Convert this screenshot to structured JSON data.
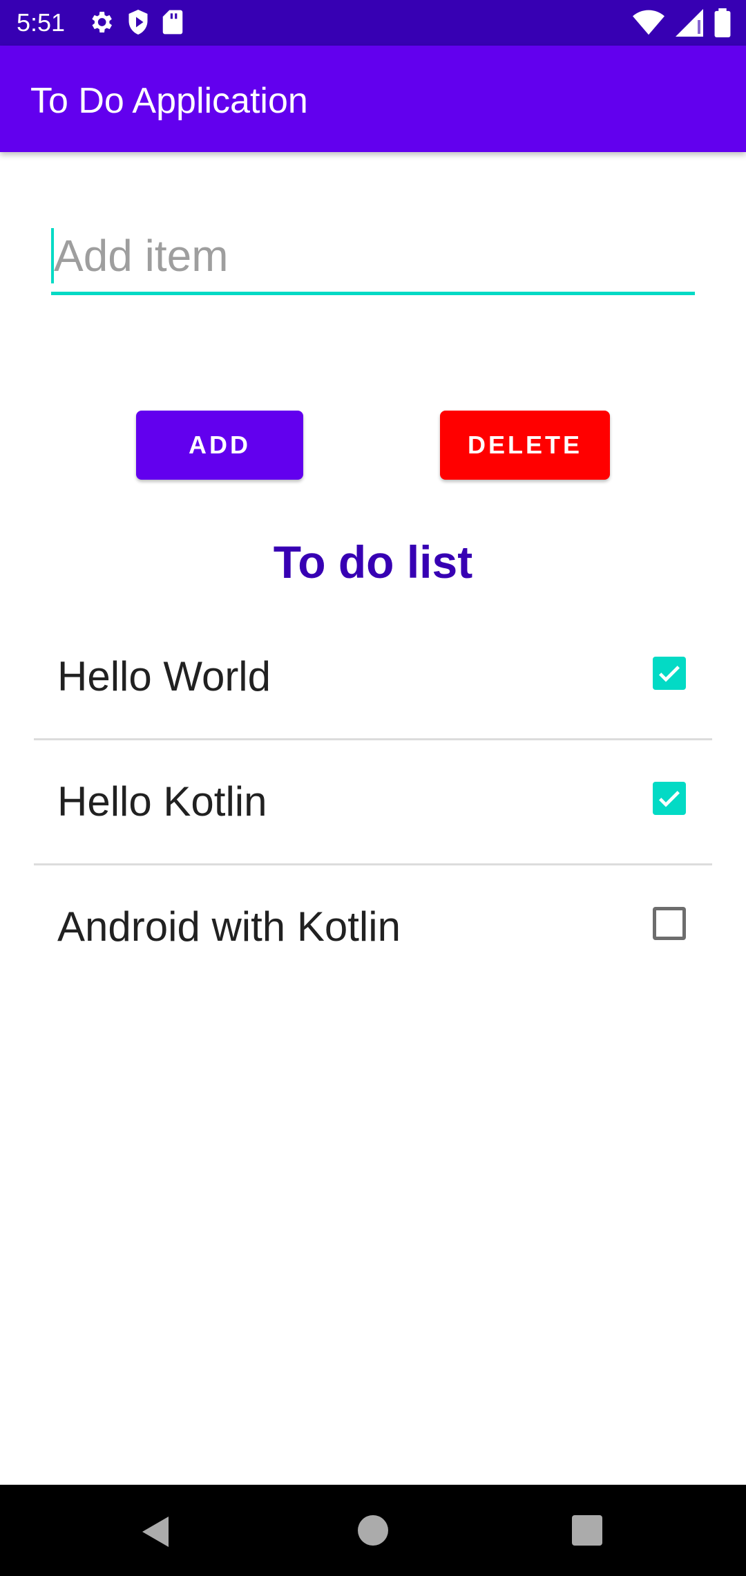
{
  "status_bar": {
    "time": "5:51",
    "left_icons": [
      "settings-icon",
      "shield-icon",
      "sd-card-icon"
    ],
    "right_icons": [
      "wifi-icon",
      "signal-icon",
      "battery-icon"
    ]
  },
  "app_bar": {
    "title": "To Do Application"
  },
  "input": {
    "placeholder": "Add item",
    "value": ""
  },
  "buttons": {
    "add_label": "ADD",
    "delete_label": "DELETE"
  },
  "list": {
    "title": "To do list",
    "items": [
      {
        "label": "Hello World",
        "checked": true
      },
      {
        "label": "Hello Kotlin",
        "checked": true
      },
      {
        "label": "Android with Kotlin",
        "checked": false
      }
    ]
  },
  "nav_bar": {
    "icons": [
      "back-icon",
      "home-icon",
      "recents-icon"
    ]
  },
  "colors": {
    "status_bar": "#3700B3",
    "app_bar": "#6200EE",
    "accent": "#03DAC5",
    "add_button": "#6200EE",
    "delete_button": "#FF0000",
    "list_title": "#3700B3"
  }
}
